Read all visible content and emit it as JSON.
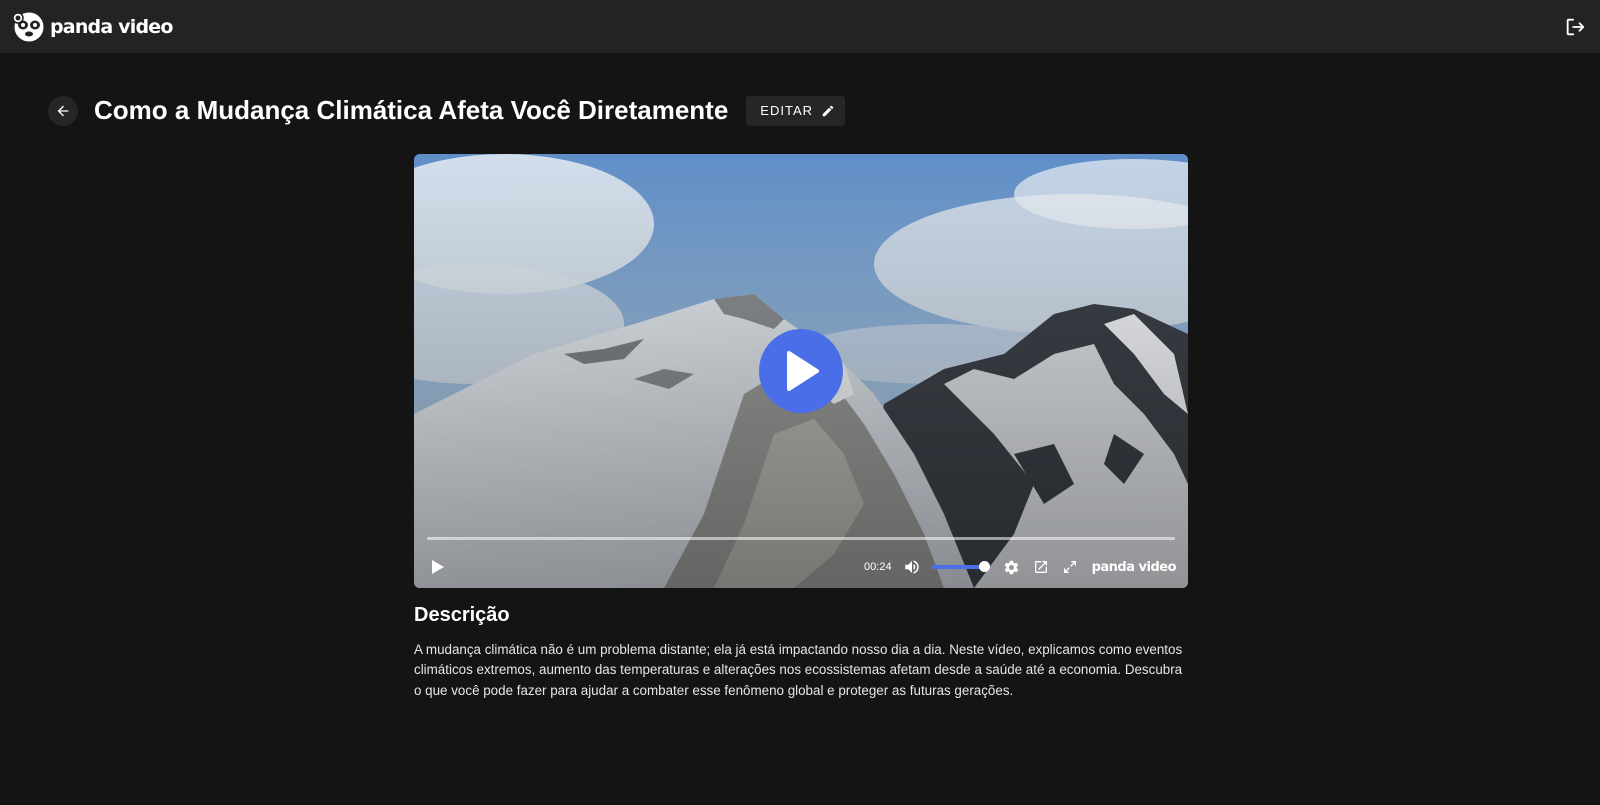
{
  "header": {
    "brand": "panda video",
    "logo_icon": "panda-logo-icon",
    "logout_icon": "logout-icon"
  },
  "page": {
    "title": "Como a Mudança Climática Afeta Você Diretamente",
    "back_icon": "arrow-left-icon",
    "edit_label": "EDITAR",
    "edit_icon": "pencil-icon"
  },
  "player": {
    "current_time": "00:24",
    "progress": 0.0,
    "volume_level": 0.9,
    "brand": "panda video",
    "accent_color": "#4a6ee8",
    "icons": [
      "play-icon",
      "volume-icon",
      "settings-icon",
      "popout-icon",
      "fullscreen-icon"
    ]
  },
  "description": {
    "heading": "Descrição",
    "text": "A mudança climática não é um problema distante; ela já está impactando nosso dia a dia. Neste vídeo, explicamos como eventos climáticos extremos, aumento das temperaturas e alterações nos ecossistemas afetam desde a saúde até a economia. Descubra o que você pode fazer para ajudar a combater esse fenômeno global e proteger as futuras gerações."
  }
}
